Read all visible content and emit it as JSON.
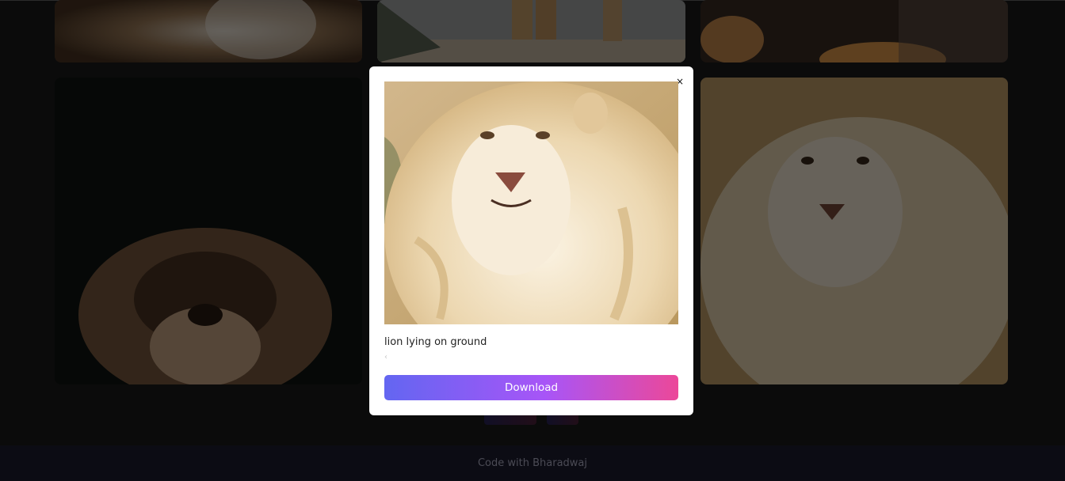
{
  "gallery": {
    "cards": [
      {
        "alt": "lion mane close-up",
        "icon": "lion-photo"
      },
      {
        "alt": "lion paws on rock",
        "icon": "lion-photo"
      },
      {
        "alt": "lion face top",
        "icon": "lion-photo"
      },
      {
        "alt": "lion looking up in dark",
        "icon": "lion-photo"
      },
      {
        "alt": "white lion portrait",
        "icon": "lion-photo"
      }
    ]
  },
  "pagination": {
    "prev_label": "Previous",
    "next_label": "Next"
  },
  "modal": {
    "close_glyph": "×",
    "caption": "lion lying on ground",
    "hint_glyph": "‹",
    "download_label": "Download"
  },
  "footer": {
    "credit": "Code with Bharadwaj"
  },
  "colors": {
    "accent_start": "#6366f1",
    "accent_mid": "#a855f7",
    "accent_end": "#ec4899",
    "overlay": "rgba(0,0,0,0.58)",
    "footer_bg": "#0c0c14"
  }
}
